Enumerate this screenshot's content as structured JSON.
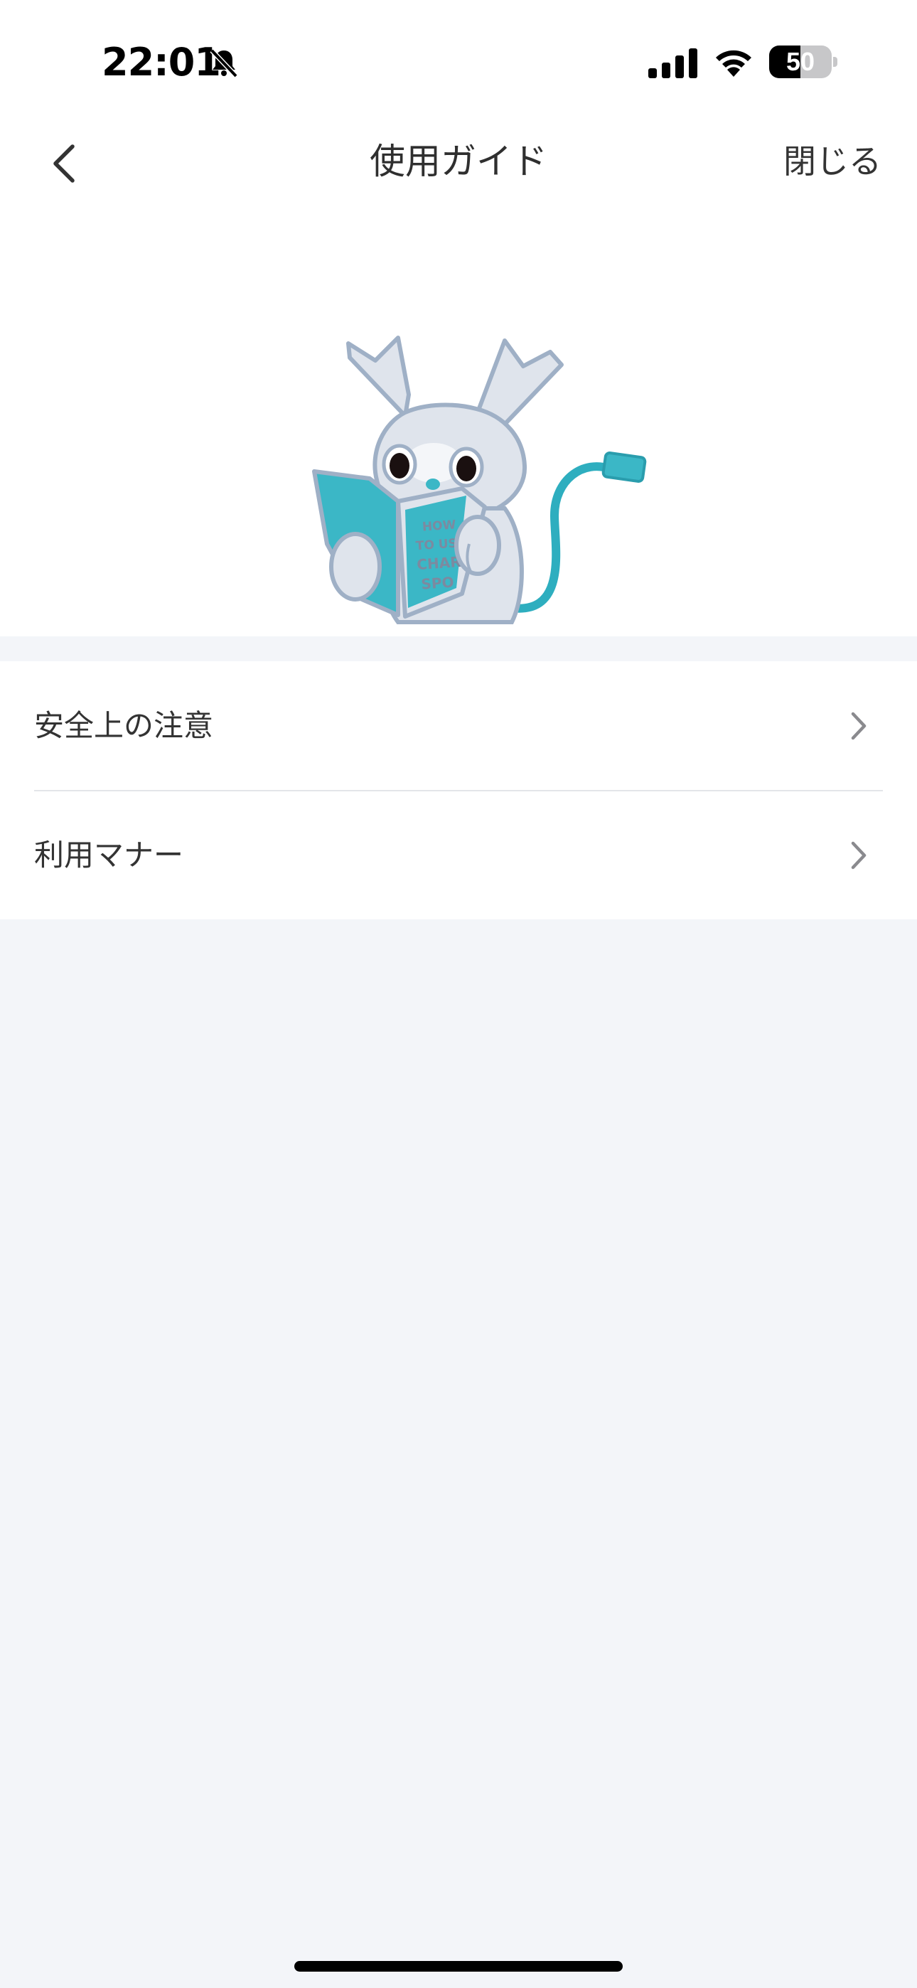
{
  "status_bar": {
    "time": "22:01",
    "battery_percent": "50",
    "battery_level": 0.5,
    "icons": [
      "bell-slash-icon",
      "cellular-signal-icon",
      "wifi-icon",
      "battery-icon"
    ]
  },
  "nav": {
    "title": "使用ガイド",
    "close_label": "閉じる",
    "back_icon": "chevron-left-icon"
  },
  "hero": {
    "illustration": "rabbit-mascot-reading-book",
    "book_text": [
      "HOW",
      "TO USE",
      "CHAR",
      "SPO"
    ],
    "colors": {
      "accent": "#3bb7c6",
      "body": "#dfe4ec",
      "outline": "#9fb0c6"
    }
  },
  "menu": {
    "items": [
      {
        "label": "安全上の注意",
        "icon": "chevron-right-icon"
      },
      {
        "label": "利用マナー",
        "icon": "chevron-right-icon"
      }
    ]
  },
  "colors": {
    "background": "#f3f5f9",
    "surface": "#ffffff",
    "divider": "#e3e5e9",
    "text": "#333333"
  }
}
